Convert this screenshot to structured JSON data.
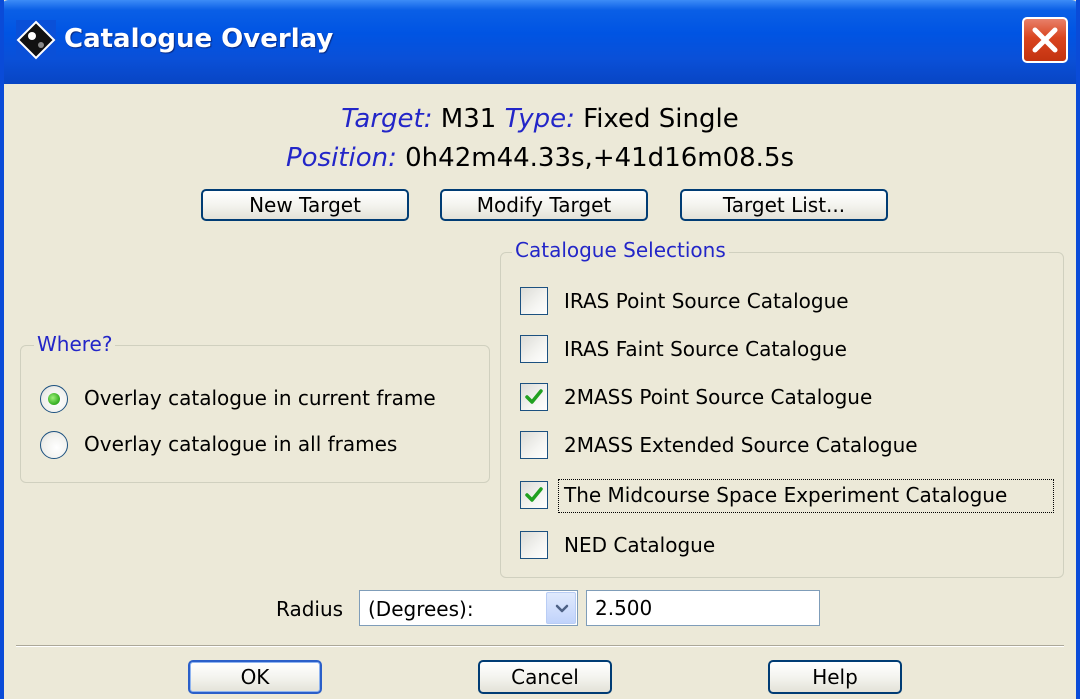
{
  "window": {
    "title": "Catalogue Overlay",
    "accent_color": "#0054e3",
    "close_color": "#d9441f"
  },
  "target_info": {
    "target_label": "Target:",
    "target_value": "M31",
    "type_label": "Type:",
    "type_value": "Fixed Single",
    "position_label": "Position:",
    "position_value": "0h42m44.33s,+41d16m08.5s"
  },
  "target_buttons": {
    "new_target": "New Target",
    "modify_target": "Modify Target",
    "target_list": "Target List..."
  },
  "where": {
    "title": "Where?",
    "options": [
      {
        "label": "Overlay catalogue in current frame",
        "selected": true
      },
      {
        "label": "Overlay catalogue in all frames",
        "selected": false
      }
    ]
  },
  "catalogue_selections": {
    "title": "Catalogue Selections",
    "items": [
      {
        "label": "IRAS Point Source Catalogue",
        "checked": false
      },
      {
        "label": "IRAS Faint Source Catalogue",
        "checked": false
      },
      {
        "label": "2MASS Point Source Catalogue",
        "checked": true
      },
      {
        "label": "2MASS Extended Source Catalogue",
        "checked": false
      },
      {
        "label": "The Midcourse Space Experiment Catalogue",
        "checked": true
      },
      {
        "label": "NED Catalogue",
        "checked": false
      }
    ]
  },
  "radius": {
    "label": "Radius",
    "unit_selected": "(Degrees):",
    "value": "2.500"
  },
  "footer": {
    "ok": "OK",
    "cancel": "Cancel",
    "help": "Help"
  }
}
